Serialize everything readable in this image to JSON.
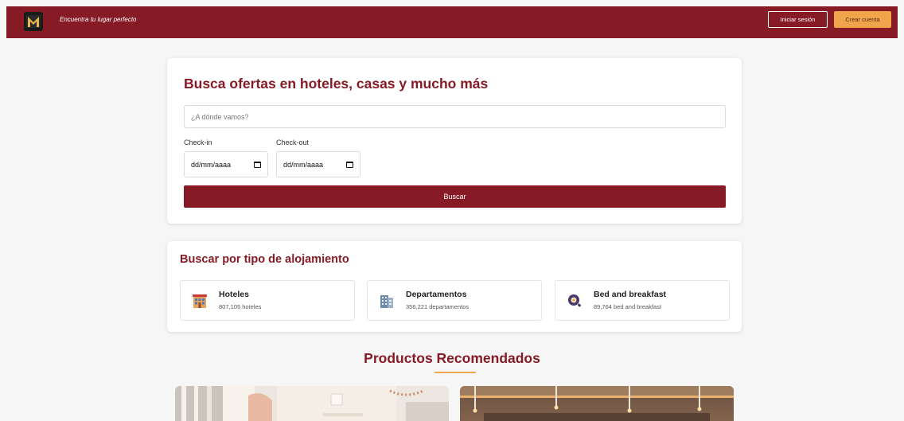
{
  "header": {
    "logo_icon": "logo-m-icon",
    "tagline": "Encuentra tu lugar perfecto",
    "login_label": "Iniciar sesión",
    "signup_label": "Crear cuenta",
    "brand_color": "#861b25",
    "accent_color": "#f0a44b"
  },
  "search": {
    "title": "Busca ofertas en hoteles, casas y mucho más",
    "destination_placeholder": "¿A dónde vamos?",
    "destination_value": "",
    "checkin_label": "Check-in",
    "checkin_value": "dd/mm/aaaa",
    "checkout_label": "Check-out",
    "checkout_value": "dd/mm/aaaa",
    "calendar_icon": "calendar-icon",
    "button_label": "Buscar"
  },
  "types": {
    "title": "Buscar por tipo de alojamiento",
    "items": [
      {
        "name": "Hoteles",
        "count": "807,105 hoteles",
        "icon": "hotel-icon"
      },
      {
        "name": "Departamentos",
        "count": "356,221 departamentos",
        "icon": "apartment-building-icon"
      },
      {
        "name": "Bed and breakfast",
        "count": "89,764 bed and breakfast",
        "icon": "bed-and-breakfast-icon"
      }
    ]
  },
  "recommended": {
    "title": "Productos Recomendados",
    "products": [
      {
        "image": "bright-bedroom-photo"
      },
      {
        "image": "warm-lit-interior-photo"
      }
    ]
  }
}
